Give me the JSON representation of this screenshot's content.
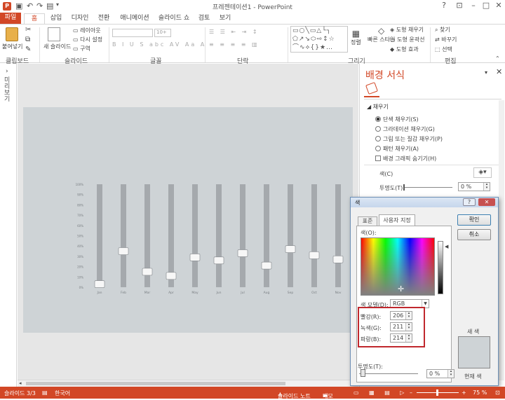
{
  "window": {
    "title": "프레젠테이션1 - PowerPoint",
    "help": "?",
    "min": "–",
    "max": "□",
    "close": "✕"
  },
  "tabs": [
    "파일",
    "홈",
    "삽입",
    "디자인",
    "전환",
    "애니메이션",
    "슬라이드 쇼",
    "검토",
    "보기"
  ],
  "ribbon": {
    "clipboard": {
      "label": "클립보드",
      "paste": "붙여넣기"
    },
    "slides": {
      "label": "슬라이드",
      "new_slide": "새 슬라이드",
      "layout": "레이아웃",
      "reset": "다시 설정",
      "section": "구역"
    },
    "font": {
      "label": "글꼴",
      "size": "10+"
    },
    "paragraph": {
      "label": "단락"
    },
    "drawing": {
      "label": "그리기",
      "arrange": "정렬",
      "quick_styles": "빠른 스타일",
      "fill": "도형 채우기",
      "outline": "도형 윤곽선",
      "effects": "도형 효과"
    },
    "editing": {
      "label": "편집",
      "find": "찾기",
      "replace": "바꾸기",
      "select": "선택"
    }
  },
  "left_pane": {
    "label": "미리 보기"
  },
  "slide_chart": {
    "chart_data": {
      "type": "bar",
      "categories": [
        "Jan",
        "Feb",
        "Mar",
        "Apr",
        "May",
        "Jun",
        "Jul",
        "Aug",
        "Sep",
        "Oct",
        "Nov"
      ],
      "values": [
        3,
        35,
        15,
        11,
        29,
        26,
        33,
        21,
        37,
        31,
        27
      ],
      "yticks": [
        "100%",
        "90%",
        "80%",
        "70%",
        "60%",
        "50%",
        "40%",
        "30%",
        "20%",
        "10%",
        "0%"
      ],
      "ylim": [
        0,
        100
      ]
    }
  },
  "format_pane": {
    "title": "배경 서식",
    "section": "채우기",
    "options": [
      {
        "label": "단색 채우기(S)",
        "selected": true
      },
      {
        "label": "그라데이션 채우기(G)",
        "selected": false
      },
      {
        "label": "그림 또는 질감 채우기(P)",
        "selected": false
      },
      {
        "label": "패턴 채우기(A)",
        "selected": false
      }
    ],
    "hide_graphics": "배경 그래픽 숨기기(H)",
    "color_label": "색(C)",
    "transparency_label": "투명도(T)",
    "transparency_value": "0 %"
  },
  "color_dialog": {
    "title": "색",
    "tabs": [
      "표준",
      "사용자 지정"
    ],
    "colors_label": "색(O):",
    "model_label": "색 모델(D):",
    "model_value": "RGB",
    "red_label": "빨강(R):",
    "red": "206",
    "green_label": "녹색(G):",
    "green": "211",
    "blue_label": "파랑(B):",
    "blue": "214",
    "transparency_label": "투명도(T):",
    "transparency_value": "0 %",
    "ok": "확인",
    "cancel": "취소",
    "new_label": "새 색",
    "current_label": "현재 색",
    "new_color": "#ced3d6",
    "current_color": "#ced3d6"
  },
  "status": {
    "slide": "슬라이드 3/3",
    "lang": "한국어",
    "notes": "슬라이드 노트",
    "comments": "메모",
    "zoom": "75 %"
  }
}
